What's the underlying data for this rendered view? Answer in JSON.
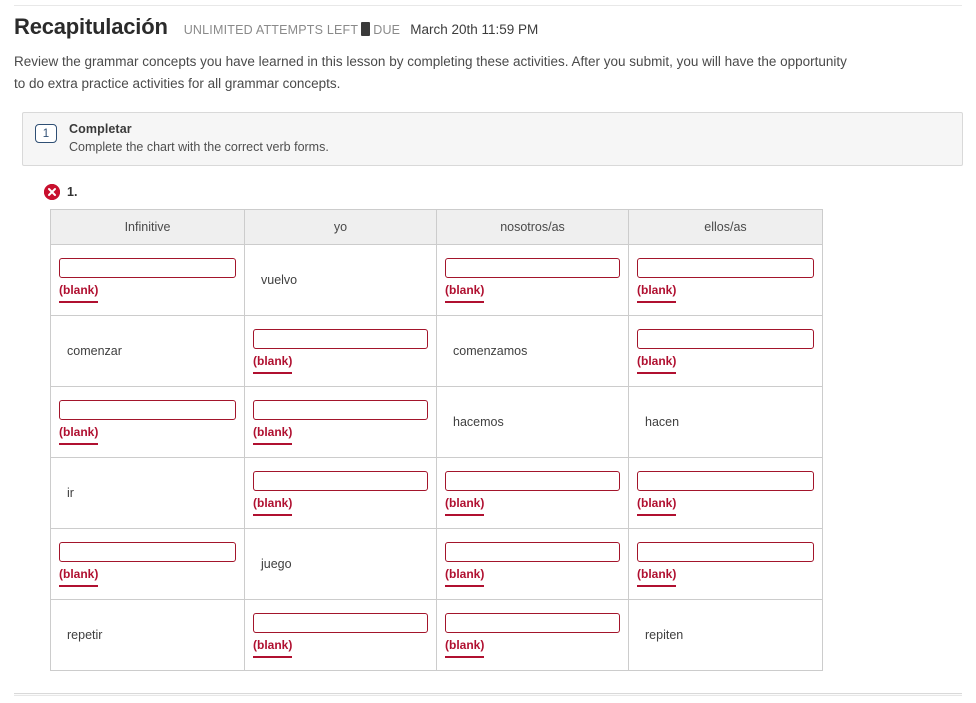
{
  "header": {
    "title": "Recapitulación",
    "attempts_text": "UNLIMITED ATTEMPTS LEFT",
    "due_label": "DUE",
    "due_date": "March 20th 11:59 PM",
    "description": "Review the grammar concepts you have learned in this lesson by completing these activities. After you submit, you will have the opportunity to do extra practice activities for all grammar concepts."
  },
  "activity": {
    "number": "1",
    "title": "Completar",
    "instructions": "Complete the chart with the correct verb forms."
  },
  "question": {
    "status": "incorrect",
    "number": "1."
  },
  "table": {
    "headers": [
      "Infinitive",
      "yo",
      "nosotros/as",
      "ellos/as"
    ],
    "blank_label": "(blank)",
    "input_value": "",
    "rows": [
      {
        "cells": [
          {
            "type": "input",
            "value": "",
            "label": "(blank)"
          },
          {
            "type": "text",
            "value": "vuelvo"
          },
          {
            "type": "input",
            "value": "",
            "label": "(blank)"
          },
          {
            "type": "input",
            "value": "",
            "label": "(blank)"
          }
        ]
      },
      {
        "cells": [
          {
            "type": "text",
            "value": "comenzar"
          },
          {
            "type": "input",
            "value": "",
            "label": "(blank)"
          },
          {
            "type": "text",
            "value": "comenzamos"
          },
          {
            "type": "input",
            "value": "",
            "label": "(blank)"
          }
        ]
      },
      {
        "cells": [
          {
            "type": "input",
            "value": "",
            "label": "(blank)"
          },
          {
            "type": "input",
            "value": "",
            "label": "(blank)"
          },
          {
            "type": "text",
            "value": "hacemos"
          },
          {
            "type": "text",
            "value": "hacen"
          }
        ]
      },
      {
        "cells": [
          {
            "type": "text",
            "value": "ir"
          },
          {
            "type": "input",
            "value": "",
            "label": "(blank)"
          },
          {
            "type": "input",
            "value": "",
            "label": "(blank)"
          },
          {
            "type": "input",
            "value": "",
            "label": "(blank)"
          }
        ]
      },
      {
        "cells": [
          {
            "type": "input",
            "value": "",
            "label": "(blank)"
          },
          {
            "type": "text",
            "value": "juego"
          },
          {
            "type": "input",
            "value": "",
            "label": "(blank)"
          },
          {
            "type": "input",
            "value": "",
            "label": "(blank)"
          }
        ]
      },
      {
        "cells": [
          {
            "type": "text",
            "value": "repetir"
          },
          {
            "type": "input",
            "value": "",
            "label": "(blank)"
          },
          {
            "type": "input",
            "value": "",
            "label": "(blank)"
          },
          {
            "type": "text",
            "value": "repiten"
          }
        ]
      }
    ]
  },
  "colors": {
    "error_red": "#c8102e",
    "input_border": "#a3152b",
    "blank_text": "#b01030",
    "badge_blue": "#2f4f74"
  }
}
